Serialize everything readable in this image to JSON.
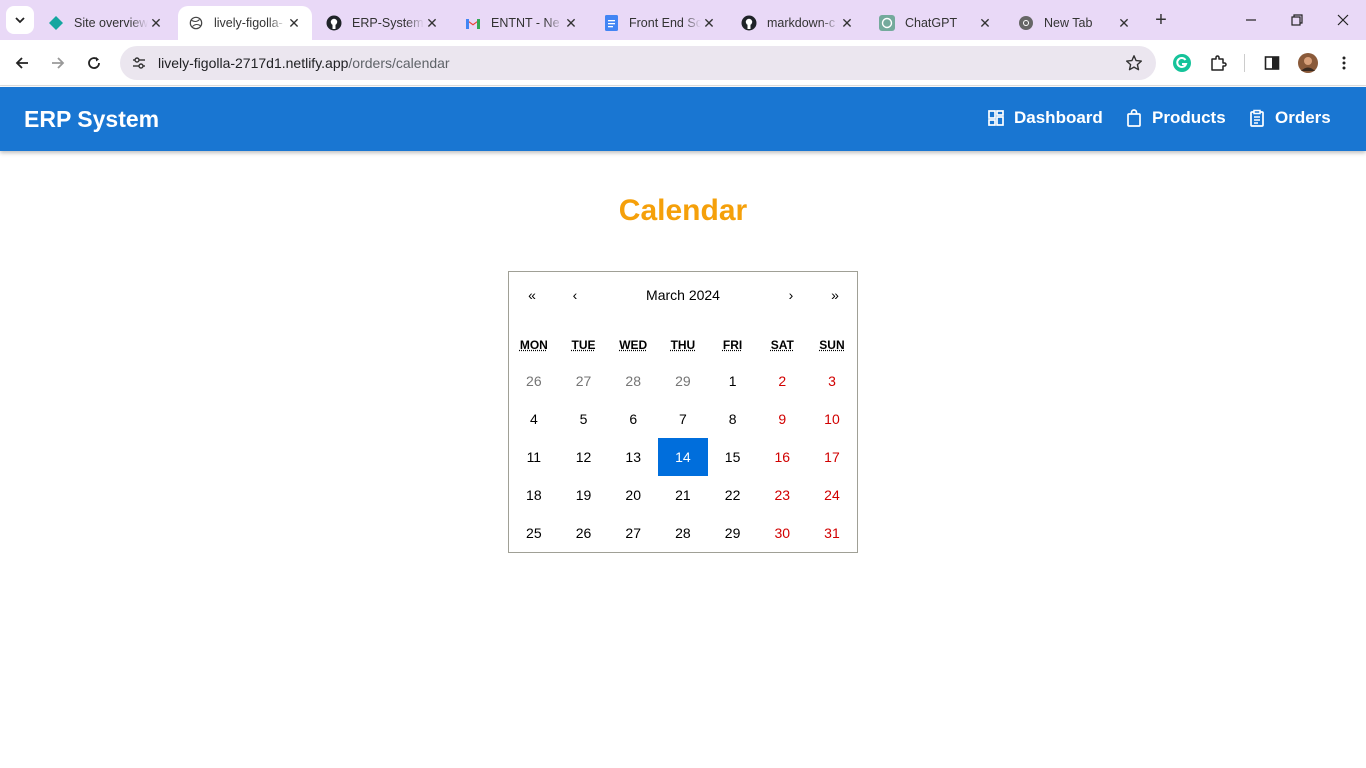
{
  "browser": {
    "tabs": [
      {
        "title": "Site overview",
        "icon": "netlify-diamond-icon",
        "active": false
      },
      {
        "title": "lively-figolla-",
        "icon": "globe-icon",
        "active": true
      },
      {
        "title": "ERP-System/",
        "icon": "github-icon",
        "active": false
      },
      {
        "title": "ENTNT - Ne",
        "icon": "gmail-icon",
        "active": false
      },
      {
        "title": "Front End Sc",
        "icon": "docs-icon",
        "active": false
      },
      {
        "title": "markdown-c",
        "icon": "github-icon",
        "active": false
      },
      {
        "title": "ChatGPT",
        "icon": "chatgpt-icon",
        "active": false
      },
      {
        "title": "New Tab",
        "icon": "chrome-icon",
        "active": false
      }
    ],
    "address": {
      "host": "lively-figolla-2717d1.netlify.app",
      "path": "/orders/calendar"
    }
  },
  "app": {
    "brand": "ERP System",
    "nav": [
      {
        "label": "Dashboard",
        "icon": "dashboard-icon"
      },
      {
        "label": "Products",
        "icon": "shopping-bag-icon"
      },
      {
        "label": "Orders",
        "icon": "clipboard-icon"
      }
    ],
    "accent": "#1976d2",
    "title_color": "#f5a00a"
  },
  "page": {
    "title": "Calendar"
  },
  "calendar": {
    "nav": {
      "prev2": "«",
      "prev": "‹",
      "label": "March 2024",
      "next": "›",
      "next2": "»"
    },
    "weekdays": [
      "MON",
      "TUE",
      "WED",
      "THU",
      "FRI",
      "SAT",
      "SUN"
    ],
    "days": [
      {
        "d": "26",
        "neighbor": true
      },
      {
        "d": "27",
        "neighbor": true
      },
      {
        "d": "28",
        "neighbor": true
      },
      {
        "d": "29",
        "neighbor": true
      },
      {
        "d": "1"
      },
      {
        "d": "2",
        "weekend": true
      },
      {
        "d": "3",
        "weekend": true
      },
      {
        "d": "4"
      },
      {
        "d": "5"
      },
      {
        "d": "6"
      },
      {
        "d": "7"
      },
      {
        "d": "8"
      },
      {
        "d": "9",
        "weekend": true
      },
      {
        "d": "10",
        "weekend": true
      },
      {
        "d": "11"
      },
      {
        "d": "12"
      },
      {
        "d": "13"
      },
      {
        "d": "14",
        "today": true
      },
      {
        "d": "15"
      },
      {
        "d": "16",
        "weekend": true
      },
      {
        "d": "17",
        "weekend": true
      },
      {
        "d": "18"
      },
      {
        "d": "19"
      },
      {
        "d": "20"
      },
      {
        "d": "21"
      },
      {
        "d": "22"
      },
      {
        "d": "23",
        "weekend": true
      },
      {
        "d": "24",
        "weekend": true
      },
      {
        "d": "25"
      },
      {
        "d": "26"
      },
      {
        "d": "27"
      },
      {
        "d": "28"
      },
      {
        "d": "29"
      },
      {
        "d": "30",
        "weekend": true
      },
      {
        "d": "31",
        "weekend": true
      }
    ],
    "today_color": "#006edc",
    "weekend_color": "#d10000"
  }
}
